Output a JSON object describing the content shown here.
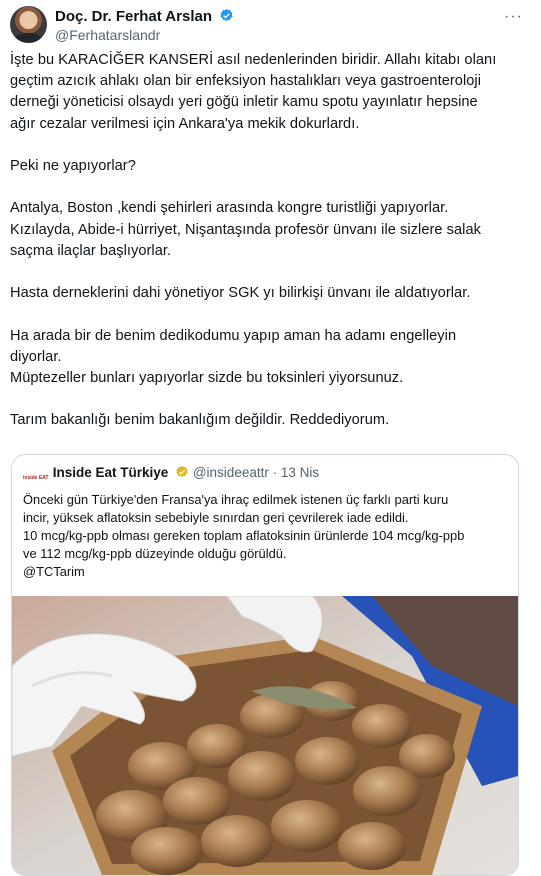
{
  "tweet": {
    "author_name": "Doç. Dr. Ferhat Arslan",
    "author_handle": "@Ferhatarslandr",
    "more_label": "···",
    "body": "İşte bu KARACİĞER KANSERİ asıl nedenlerinden biridir. Allahı kitabı olanı\ngeçtim azıcık ahlakı olan bir enfeksiyon hastalıkları veya gastroenteroloji\nderneği yöneticisi olsaydı yeri göğü inletir kamu spotu yayınlatır hepsine\nağır cezalar verilmesi için Ankara'ya mekik dokurlardı.\n\nPeki ne yapıyorlar?\n\nAntalya, Boston ,kendi şehirleri arasında kongre turistliği yapıyorlar.\nKızılayda, Abide-i hürriyet, Nişantaşında profesör ünvanı ile sizlere salak\nsaçma ilaçlar başlıyorlar.\n\nHasta derneklerini dahi yönetiyor SGK yı bilirkişi ünvanı ile aldatıyorlar.\n\nHa arada bir de benim dedikodumu yapıp aman ha adamı engelleyin\ndiyorlar.\nMüptezeller bunları yapıyorlar sizde bu toksinleri yiyorsunuz.\n\nTarım bakanlığı benim bakanlığım değildir. Reddediyorum."
  },
  "quoted": {
    "logo_text": "inside EAT",
    "name": "Inside Eat Türkiye",
    "handle": "@insideeattr",
    "separator": "·",
    "date": "13 Nis",
    "text": "Önceki gün Türkiye'den Fransa'ya ihraç edilmek istenen üç farklı parti kuru\nincir, yüksek aflatoksin sebebiyle sınırdan geri çevrilerek iade edildi.\n10 mcg/kg-ppb olması gereken toplam aflatoksinin ürünlerde 104 mcg/kg-ppb\nve 112 mcg/kg-ppb düzeyinde olduğu görüldü.\n@TCTarim",
    "image_subject": "gloved hands holding a box of dried figs with a bay leaf"
  },
  "colors": {
    "text": "#0f1419",
    "secondary": "#536471",
    "verified_blue": "#1d9bf0",
    "verified_gold": "#e2b719",
    "border": "#cfd9de"
  }
}
